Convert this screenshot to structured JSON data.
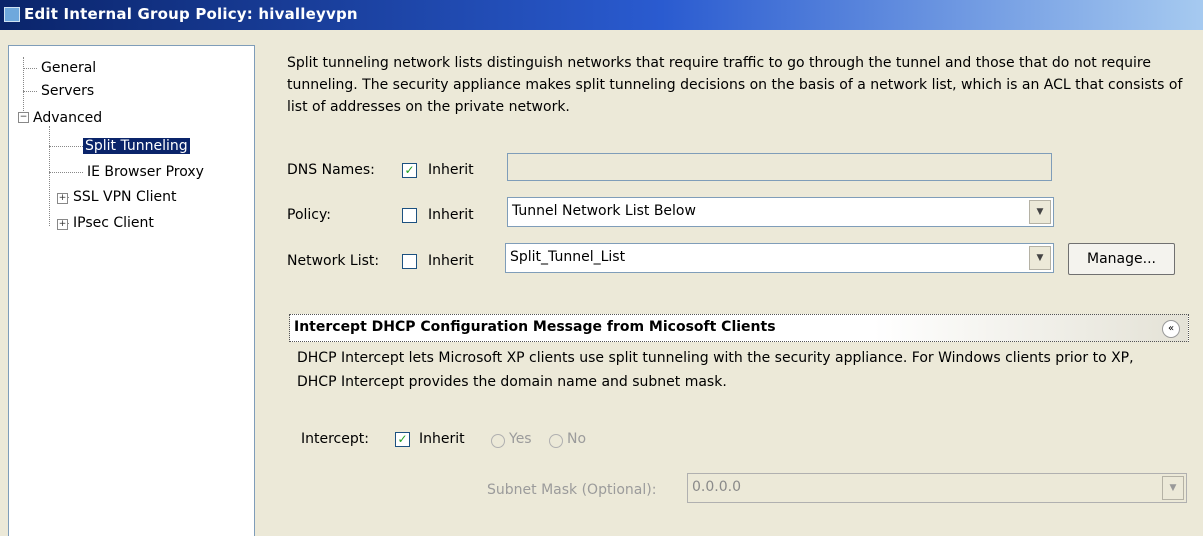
{
  "window": {
    "title": "Edit Internal Group Policy: hivalleyvpn"
  },
  "tree": {
    "general": "General",
    "servers": "Servers",
    "advanced": "Advanced",
    "split_tunneling": "Split Tunneling",
    "ie_browser_proxy": "IE Browser Proxy",
    "ssl_vpn_client": "SSL VPN Client",
    "ipsec_client": "IPsec Client"
  },
  "split": {
    "description": "Split tunneling network lists distinguish networks that require traffic to go through the tunnel and those that do not require tunneling. The security appliance makes split tunneling decisions on the basis of a network list, which is an ACL that consists of list of addresses on the private network.",
    "dns_label": "DNS Names:",
    "dns_inherit_label": "Inherit",
    "dns_value": "",
    "policy_label": "Policy:",
    "policy_inherit_label": "Inherit",
    "policy_value": "Tunnel Network List Below",
    "network_list_label": "Network List:",
    "network_list_inherit_label": "Inherit",
    "network_list_value": "Split_Tunnel_List",
    "manage_button": "Manage..."
  },
  "dhcp": {
    "section_title": "Intercept DHCP Configuration Message from Micosoft Clients",
    "description": "DHCP Intercept lets Microsoft XP clients use split tunneling with the security appliance. For Windows clients prior to XP, DHCP Intercept provides the domain name and subnet mask.",
    "intercept_label": "Intercept:",
    "inherit_label": "Inherit",
    "yes_label": "Yes",
    "no_label": "No",
    "subnet_label": "Subnet Mask (Optional):",
    "subnet_value": "0.0.0.0"
  },
  "checks": {
    "dns_inherit": true,
    "policy_inherit": false,
    "network_list_inherit": false,
    "intercept_inherit": true
  },
  "icons": {
    "checkmark": "✓",
    "dropdown": "▼",
    "collapse": "«",
    "plus": "+",
    "minus": "−"
  }
}
